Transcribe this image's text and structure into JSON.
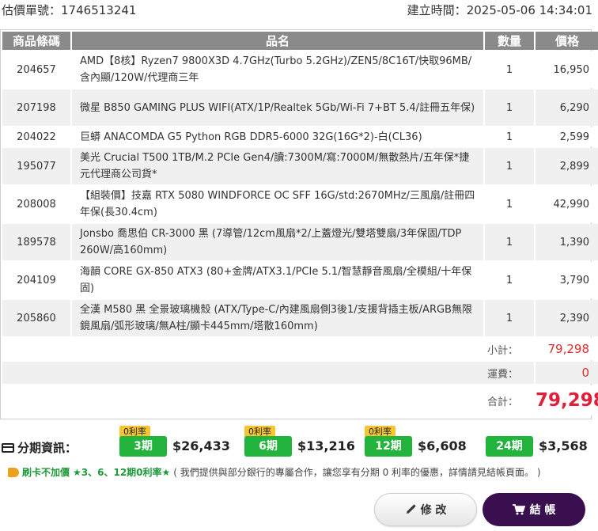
{
  "header": {
    "quote_label": "估價單號：",
    "quote_no": "1746513241",
    "created_label": "建立時間：",
    "created_at": "2025-05-06 14:34:01"
  },
  "table": {
    "columns": [
      "商品條碼",
      "品名",
      "數量",
      "價格"
    ],
    "rows": [
      {
        "code": "204657",
        "name": "AMD【8核】Ryzen7 9800X3D 4.7GHz(Turbo 5.2GHz)/ZEN5/8C16T/快取96MB/含內顯/120W/代理商三年",
        "qty": "1",
        "price": "16,950"
      },
      {
        "code": "207198",
        "name": "微星 B850 GAMING PLUS WIFI(ATX/1P/Realtek 5Gb/Wi-Fi 7+BT 5.4/註冊五年保)",
        "qty": "1",
        "price": "6,290"
      },
      {
        "code": "204022",
        "name": "巨蟒 ANACOMDA G5 Python RGB DDR5-6000 32G(16G*2)-白(CL36)",
        "qty": "1",
        "price": "2,599"
      },
      {
        "code": "195077",
        "name": "美光 Crucial T500 1TB/M.2 PCIe Gen4/讀:7300M/寫:7000M/無散熱片/五年保*捷元代理商公司貨*",
        "qty": "1",
        "price": "2,899"
      },
      {
        "code": "208008",
        "name": "【組裝價】技嘉 RTX 5080 WINDFORCE OC SFF 16G/std:2670MHz/三風扇/註冊四年保(長30.4cm)",
        "qty": "1",
        "price": "42,990"
      },
      {
        "code": "189578",
        "name": "Jonsbo 喬思伯 CR-3000 黑 (7導管/12cm風扇*2/上蓋燈光/雙塔雙扇/3年保固/TDP 260W/高160mm)",
        "qty": "1",
        "price": "1,390"
      },
      {
        "code": "204109",
        "name": "海韻 CORE GX-850 ATX3 (80+金牌/ATX3.1/PCIe 5.1/智慧靜音風扇/全模組/十年保固)",
        "qty": "1",
        "price": "3,790"
      },
      {
        "code": "205860",
        "name": "全漢 M580 黑 全景玻璃機殼 (ATX/Type-C/內建風扇側3後1/支援背插主板/ARGB無限鏡風扇/弧形玻璃/無A柱/顯卡445mm/塔散160mm)",
        "qty": "1",
        "price": "2,390"
      }
    ],
    "subtotal_label": "小計：",
    "subtotal": "79,298",
    "shipping_label": "運費：",
    "shipping": "0",
    "total_label": "合計：",
    "total": "79,298"
  },
  "installments": {
    "title": "分期資訊：",
    "plans": [
      {
        "badge": "0利率",
        "term": "3期",
        "amount": "$26,433"
      },
      {
        "badge": "0利率",
        "term": "6期",
        "amount": "$13,216"
      },
      {
        "badge": "0利率",
        "term": "12期",
        "amount": "$6,608"
      },
      {
        "badge": "",
        "term": "24期",
        "amount": "$3,568"
      }
    ]
  },
  "promo": {
    "label": "刷卡不加價",
    "highlight": "★3、6、12期0利率★",
    "text": "( 我們提供與部分銀行的專屬合作，讓您享有分期 0 利率的優惠，詳情請見結帳頁面。 )"
  },
  "buttons": {
    "edit": "修 改",
    "checkout": "結 帳"
  },
  "colors": {
    "header_gray": "#8a8a8a",
    "total_red": "#e0203a",
    "term_green": "#22b43c",
    "badge_yellow": "#f6c632",
    "checkout_purple": "#3a0f4f"
  }
}
